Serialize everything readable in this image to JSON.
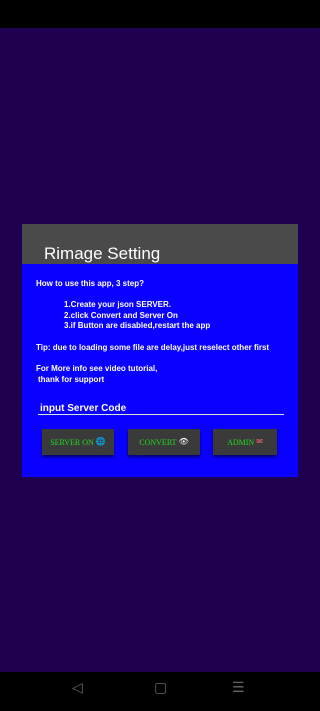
{
  "nav": {
    "back_glyph": "◁",
    "home_glyph": "▢",
    "recent_glyph": "☰"
  },
  "dialog": {
    "title": "Rimage Setting",
    "how_to": "How to use this app, 3 step?",
    "step1": "1.Create your json SERVER.",
    "step2": "2.click Convert and Server On",
    "step3": "3.if Button are disabled,restart the app",
    "tip": "Tip: due to loading some file are delay,just reselect other first",
    "info_line1": "For More info see video tutorial,",
    "info_line2": " thank for support",
    "input_placeholder": "input Server Code",
    "input_value": "",
    "buttons": {
      "server_on": {
        "label": "SERVER ON",
        "icon": "globe-icon",
        "glyph": "🌐"
      },
      "convert": {
        "label": "CONVERT",
        "icon": "eye-icon",
        "glyph": "👁"
      },
      "admin": {
        "label": "ADMIN",
        "icon": "mail-icon",
        "glyph": "✉"
      }
    }
  },
  "colors": {
    "background": "#1f0050",
    "dialog": "#0a00ff",
    "header": "#4a4a4a",
    "button": "#3a3a3a",
    "button_text": "#22dd22"
  }
}
